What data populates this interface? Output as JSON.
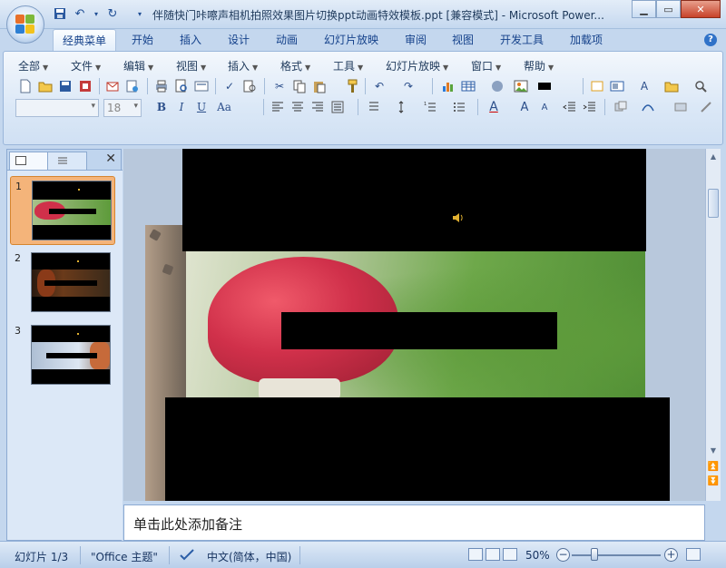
{
  "window": {
    "title": "伴随快门咔嚓声相机拍照效果图片切换ppt动画特效模板.ppt [兼容模式] - Microsoft Power..."
  },
  "ribbon_tabs": [
    {
      "label": "经典菜单",
      "active": true
    },
    {
      "label": "开始"
    },
    {
      "label": "插入"
    },
    {
      "label": "设计"
    },
    {
      "label": "动画"
    },
    {
      "label": "幻灯片放映"
    },
    {
      "label": "审阅"
    },
    {
      "label": "视图"
    },
    {
      "label": "开发工具"
    },
    {
      "label": "加载项"
    }
  ],
  "classic_menu": [
    {
      "label": "全部"
    },
    {
      "label": "文件"
    },
    {
      "label": "编辑"
    },
    {
      "label": "视图"
    },
    {
      "label": "插入"
    },
    {
      "label": "格式"
    },
    {
      "label": "工具"
    },
    {
      "label": "幻灯片放映"
    },
    {
      "label": "窗口"
    },
    {
      "label": "帮助"
    }
  ],
  "format_bar": {
    "font_name": "",
    "font_size": "18",
    "bold": "B",
    "italic": "I",
    "underline": "U",
    "case": "Aa",
    "font_color_glyph": "A",
    "grow_font": "A",
    "shrink_font": "A"
  },
  "slides": [
    {
      "number": "1",
      "selected": true
    },
    {
      "number": "2"
    },
    {
      "number": "3"
    }
  ],
  "notes": {
    "placeholder": "单击此处添加备注"
  },
  "status": {
    "slide_indicator": "幻灯片 1/3",
    "theme": "\"Office 主题\"",
    "language": "中文(简体，中国)",
    "zoom": "50%",
    "zoom_level_percent": 50
  },
  "colors": {
    "accent_selected_thumb": "#f4b47a",
    "ribbon": "#dbe8f7",
    "mushroom_cap": "#d0304a",
    "foliage": "#5e9b3b"
  }
}
